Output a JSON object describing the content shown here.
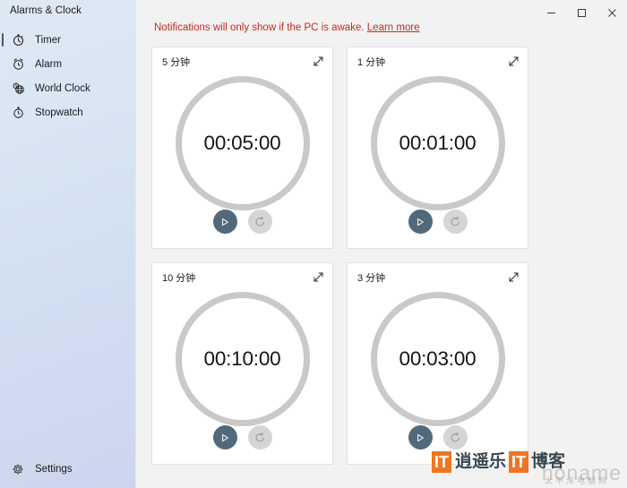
{
  "window": {
    "app_title": "Alarms & Clock",
    "buttons": [
      {
        "name": "minimize",
        "glyph": "─"
      },
      {
        "name": "maximize",
        "glyph": "□"
      },
      {
        "name": "close",
        "glyph": "✕"
      }
    ]
  },
  "sidebar": {
    "items": [
      {
        "label": "Timer",
        "icon": "timer-icon",
        "selected": true
      },
      {
        "label": "Alarm",
        "icon": "alarm-icon",
        "selected": false
      },
      {
        "label": "World Clock",
        "icon": "globe-icon",
        "selected": false
      },
      {
        "label": "Stopwatch",
        "icon": "stopwatch-icon",
        "selected": false
      }
    ],
    "settings": {
      "label": "Settings",
      "icon": "gear-icon"
    }
  },
  "banner": {
    "message": "Notifications will only show if the PC is awake.",
    "link_label": "Learn more",
    "color": "#c42b1c"
  },
  "timers": [
    {
      "title": "5 分钟",
      "time": "00:05:00",
      "play_label": "Start",
      "reset_label": "Reset",
      "expand_label": "Expand"
    },
    {
      "title": "1 分钟",
      "time": "00:01:00",
      "play_label": "Start",
      "reset_label": "Reset",
      "expand_label": "Expand"
    },
    {
      "title": "10 分钟",
      "time": "00:10:00",
      "play_label": "Start",
      "reset_label": "Reset",
      "expand_label": "Expand"
    },
    {
      "title": "3 分钟",
      "time": "00:03:00",
      "play_label": "Start",
      "reset_label": "Reset",
      "expand_label": "Expand"
    }
  ],
  "watermark": {
    "badge1": "IT",
    "text1": "逍遥乐",
    "badge2": "IT",
    "text2": "博客",
    "faint": "noname",
    "faint2": "太平洋电脑网",
    "accent": "#ee7623"
  },
  "colors": {
    "dial_ring": "#c9c9c9",
    "play_button": "#51697a",
    "reset_button": "#d5d5d5",
    "card_bg": "#ffffff",
    "main_bg": "#f2f2f2"
  }
}
